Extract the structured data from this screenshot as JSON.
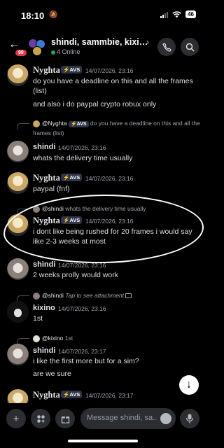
{
  "status_bar": {
    "time": "18:10",
    "battery": "46"
  },
  "header": {
    "back_icon": "arrow-left-icon",
    "unread_badge": "99",
    "title": "shindi, sammbie, kixi…",
    "chevron": "›",
    "online_text": "4 Online"
  },
  "messages": [
    {
      "author": "Nyghta",
      "tag": "⚡AVS",
      "timestamp": "14/07/2026, 23:16",
      "lines": [
        "do you have a deadline on this and all the frames (list)",
        "and also i do paypal crypto robux only"
      ]
    },
    {
      "reply_author": "@Nyghta",
      "reply_tag": "⚡AVS",
      "reply_text": "do you have a deadline on this and all the frames (list)",
      "author": "shindi",
      "timestamp": "14/07/2026, 23:16",
      "lines": [
        "whats the delivery time usually"
      ]
    },
    {
      "author": "Nyghta",
      "tag": "⚡AVS",
      "timestamp": "14/07/2026, 23:16",
      "lines": [
        "paypal (fnf)"
      ]
    },
    {
      "reply_author": "@shindi",
      "reply_text": "whats the delivery time usually",
      "author": "Nyghta",
      "tag": "⚡AVS",
      "timestamp": "14/07/2026, 23:16",
      "lines": [
        "i dont like being rushed for 20 frames i would say like 2-3 weeks at most"
      ]
    },
    {
      "author": "shindi",
      "timestamp": "14/07/2026, 23:16",
      "lines": [
        "2 weeks prolly would work"
      ]
    },
    {
      "reply_author": "@shindi",
      "reply_text": "Tap to see attachment",
      "author": "kixino",
      "timestamp": "14/07/2026, 23:16",
      "lines": [
        "1st"
      ]
    },
    {
      "reply_author": "@kixino",
      "reply_text": "1st",
      "author": "shindi",
      "timestamp": "14/07/2026, 23:17",
      "lines": [
        "i like the first more but for a sim?",
        "are we sure"
      ]
    },
    {
      "author": "Nyghta",
      "tag": "⚡AVS",
      "timestamp": "14/07/2026, 23:17"
    }
  ],
  "composer": {
    "placeholder": "Message shindi, sa..."
  }
}
